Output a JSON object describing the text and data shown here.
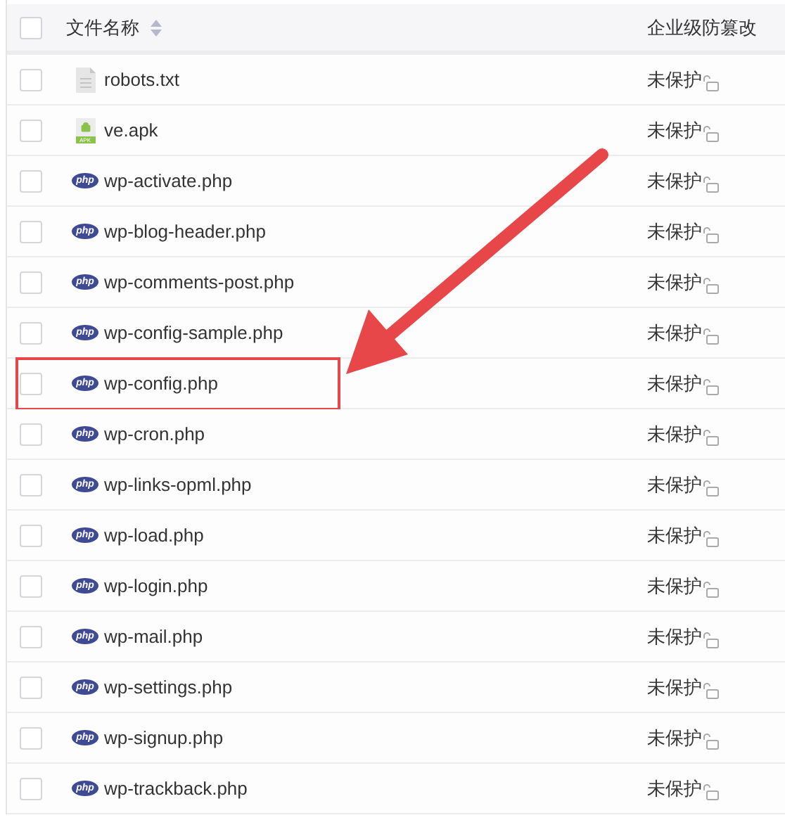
{
  "table": {
    "columns": [
      {
        "label": "文件名称",
        "sortable": true
      },
      {
        "label": "企业级防篡改",
        "sortable": false
      }
    ],
    "header_checked": false,
    "rows": [
      {
        "kind": "txt",
        "name": "robots.txt",
        "status": "未保护",
        "checked": false,
        "highlighted": false
      },
      {
        "kind": "apk",
        "badge": "APK",
        "name": "ve.apk",
        "status": "未保护",
        "checked": false,
        "highlighted": false
      },
      {
        "kind": "php",
        "badge": "php",
        "name": "wp-activate.php",
        "status": "未保护",
        "checked": false,
        "highlighted": false
      },
      {
        "kind": "php",
        "badge": "php",
        "name": "wp-blog-header.php",
        "status": "未保护",
        "checked": false,
        "highlighted": false
      },
      {
        "kind": "php",
        "badge": "php",
        "name": "wp-comments-post.php",
        "status": "未保护",
        "checked": false,
        "highlighted": false
      },
      {
        "kind": "php",
        "badge": "php",
        "name": "wp-config-sample.php",
        "status": "未保护",
        "checked": false,
        "highlighted": false
      },
      {
        "kind": "php",
        "badge": "php",
        "name": "wp-config.php",
        "status": "未保护",
        "checked": false,
        "highlighted": true
      },
      {
        "kind": "php",
        "badge": "php",
        "name": "wp-cron.php",
        "status": "未保护",
        "checked": false,
        "highlighted": false
      },
      {
        "kind": "php",
        "badge": "php",
        "name": "wp-links-opml.php",
        "status": "未保护",
        "checked": false,
        "highlighted": false
      },
      {
        "kind": "php",
        "badge": "php",
        "name": "wp-load.php",
        "status": "未保护",
        "checked": false,
        "highlighted": false
      },
      {
        "kind": "php",
        "badge": "php",
        "name": "wp-login.php",
        "status": "未保护",
        "checked": false,
        "highlighted": false
      },
      {
        "kind": "php",
        "badge": "php",
        "name": "wp-mail.php",
        "status": "未保护",
        "checked": false,
        "highlighted": false
      },
      {
        "kind": "php",
        "badge": "php",
        "name": "wp-settings.php",
        "status": "未保护",
        "checked": false,
        "highlighted": false
      },
      {
        "kind": "php",
        "badge": "php",
        "name": "wp-signup.php",
        "status": "未保护",
        "checked": false,
        "highlighted": false
      },
      {
        "kind": "php",
        "badge": "php",
        "name": "wp-trackback.php",
        "status": "未保护",
        "checked": false,
        "highlighted": false
      }
    ]
  }
}
